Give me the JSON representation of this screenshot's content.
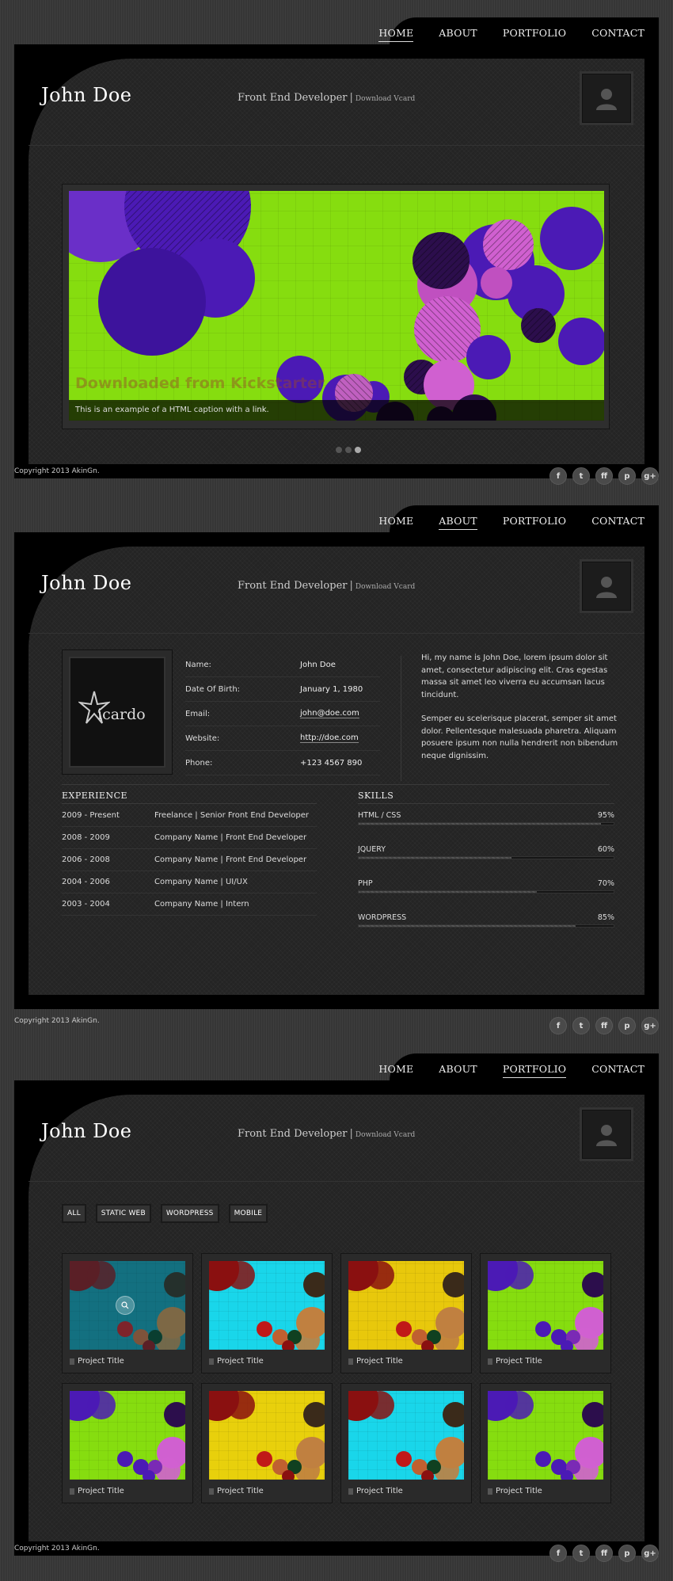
{
  "nav": [
    "HOME",
    "ABOUT",
    "PORTFOLIO",
    "CONTACT"
  ],
  "header": {
    "name": "John Doe",
    "title": "Front End Developer",
    "separator": "|",
    "vcard": "Download Vcard"
  },
  "footer": {
    "copyright": "Copyright 2013 AkinGn.",
    "socials": [
      {
        "icon": "facebook-icon",
        "glyph": "f"
      },
      {
        "icon": "twitter-icon",
        "glyph": "t"
      },
      {
        "icon": "flickr-icon",
        "glyph": "ff"
      },
      {
        "icon": "pinterest-icon",
        "glyph": "p"
      },
      {
        "icon": "google-plus-icon",
        "glyph": "g+"
      }
    ]
  },
  "home": {
    "active_nav": "HOME",
    "slide_watermark": "Downloaded from Kickstarter",
    "caption_text": "This is an example of a HTML caption with a ",
    "caption_link": "link",
    "caption_end": ".",
    "dots": 3,
    "active_dot": 2
  },
  "about": {
    "active_nav": "ABOUT",
    "logo_text": "icardo",
    "info": [
      {
        "label": "Name:",
        "value": "John Doe",
        "link": false
      },
      {
        "label": "Date Of Birth:",
        "value": "January 1, 1980",
        "link": false
      },
      {
        "label": "Email:",
        "value": "john@doe.com",
        "link": true
      },
      {
        "label": "Website:",
        "value": "http://doe.com",
        "link": true
      },
      {
        "label": "Phone:",
        "value": "+123 4567 890",
        "link": false
      }
    ],
    "bio_p1": "Hi, my name is John Doe, lorem ipsum dolor sit amet, consectetur adipiscing elit. Cras egestas massa sit amet leo viverra eu accumsan lacus tincidunt.",
    "bio_p2": "Semper eu scelerisque placerat, semper sit amet dolor. Pellentesque malesuada pharetra. Aliquam posuere ipsum non nulla hendrerit non bibendum neque dignissim.",
    "experience_title": "EXPERIENCE",
    "experience": [
      {
        "years": "2009 - Present",
        "role": "Freelance | Senior Front End Developer"
      },
      {
        "years": "2008 - 2009",
        "role": "Company Name | Front End Developer"
      },
      {
        "years": "2006 - 2008",
        "role": "Company Name | Front End Developer"
      },
      {
        "years": "2004 - 2006",
        "role": "Company Name | UI/UX"
      },
      {
        "years": "2003 - 2004",
        "role": "Company Name | Intern"
      }
    ],
    "skills_title": "SKILLS",
    "skills": [
      {
        "name": "HTML / CSS",
        "percent": "95%",
        "value": 95
      },
      {
        "name": "JQUERY",
        "percent": "60%",
        "value": 60
      },
      {
        "name": "PHP",
        "percent": "70%",
        "value": 70
      },
      {
        "name": "WORDPRESS",
        "percent": "85%",
        "value": 85
      }
    ]
  },
  "portfolio": {
    "active_nav": "PORTFOLIO",
    "filters": [
      "ALL",
      "STATIC WEB",
      "WORDPRESS",
      "MOBILE"
    ],
    "projects": [
      {
        "title": "Project Title",
        "color": "#1e8c9a",
        "hover": true
      },
      {
        "title": "Project Title",
        "color": "#19d6ea",
        "hover": false
      },
      {
        "title": "Project Title",
        "color": "#e8c80c",
        "hover": false
      },
      {
        "title": "Project Title",
        "color": "#86dd0f",
        "hover": false
      },
      {
        "title": "Project Title",
        "color": "#86dd0f",
        "hover": false
      },
      {
        "title": "Project Title",
        "color": "#e8d00c",
        "hover": false
      },
      {
        "title": "Project Title",
        "color": "#19d6ea",
        "hover": false
      },
      {
        "title": "Project Title",
        "color": "#86dd0f",
        "hover": false
      }
    ]
  },
  "colors": {
    "slide_green": "#86dd0f",
    "circle_purple": "#4b1ab5",
    "circle_pink": "#d060d0"
  }
}
